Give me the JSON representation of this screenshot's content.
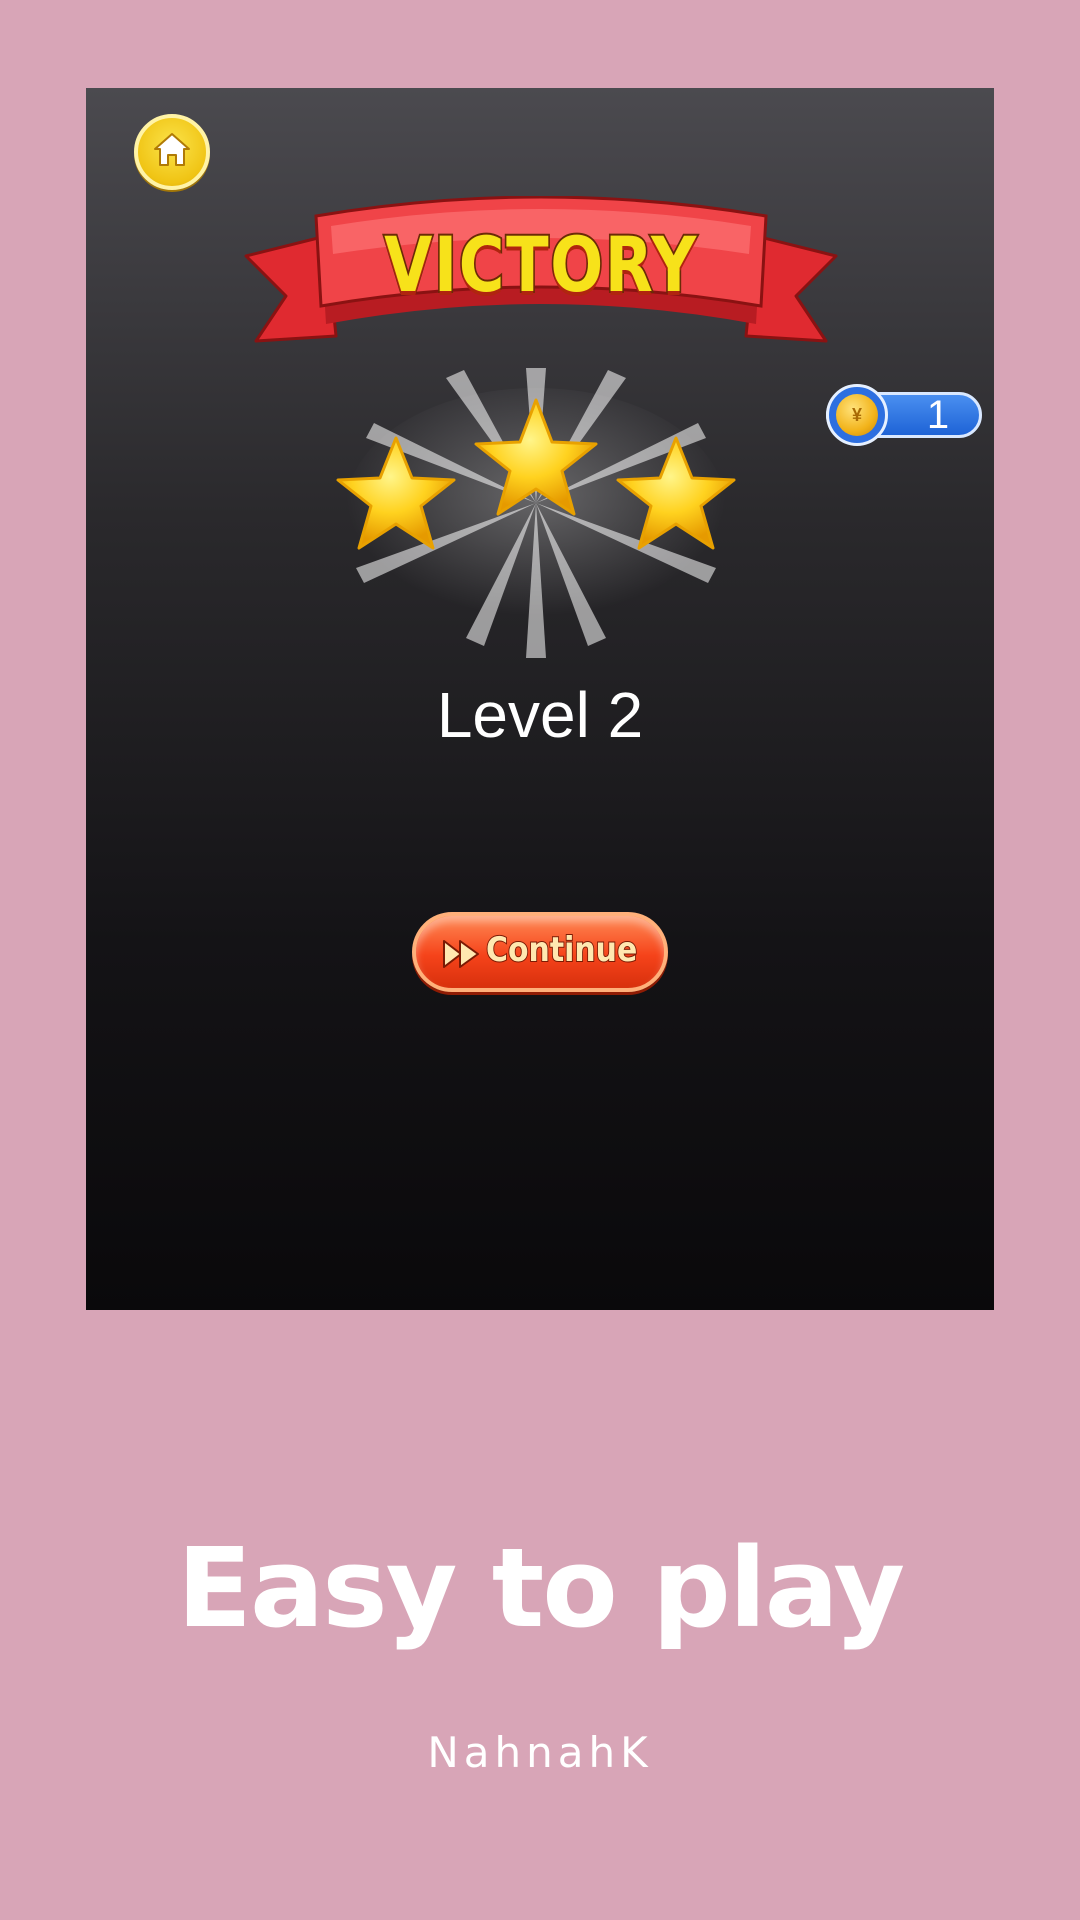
{
  "game": {
    "banner_title": "VICTORY",
    "level_label": "Level 2",
    "coins": "1",
    "coin_symbol": "¥",
    "stars_earned": 3,
    "stars_total": 3,
    "continue_label": "Continue",
    "home_icon": "home-icon"
  },
  "promo": {
    "headline": "Easy to play",
    "author": "NahnahK"
  },
  "colors": {
    "background": "#d8a5b7",
    "banner_red": "#e8383d",
    "title_yellow": "#f7e21a",
    "coin_blue": "#1e63d6",
    "button_orange": "#f5431a",
    "star_yellow": "#ffd21f"
  }
}
